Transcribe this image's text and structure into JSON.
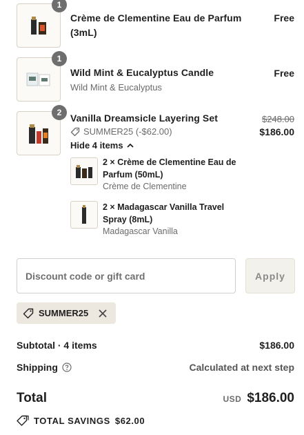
{
  "line_items": [
    {
      "quantity": "1",
      "title": "Crème de Clementine Eau de Parfum (3mL)",
      "subtitle": "",
      "price": "Free"
    },
    {
      "quantity": "1",
      "title": "Wild Mint & Eucalyptus Candle",
      "subtitle": "Wild Mint & Eucalyptus",
      "price": "Free"
    },
    {
      "quantity": "2",
      "title": "Vanilla Dreamsicle Layering Set",
      "original_price": "$248.00",
      "price": "$186.00",
      "discount_code": "SUMMER25 (-$62.00)",
      "toggle_label": "Hide 4 items",
      "components": [
        {
          "title": "2 × Crème de Clementine Eau de Parfum (50mL)",
          "subtitle": "Crème de Clementine"
        },
        {
          "title": "2 × Madagascar Vanilla Travel Spray (8mL)",
          "subtitle": "Madagascar Vanilla"
        }
      ]
    }
  ],
  "discount": {
    "placeholder": "Discount code or gift card",
    "apply_label": "Apply",
    "applied_code": "SUMMER25"
  },
  "summary": {
    "subtotal_label": "Subtotal · 4 items",
    "subtotal_value": "$186.00",
    "shipping_label": "Shipping",
    "shipping_value": "Calculated at next step",
    "total_label": "Total",
    "currency": "USD",
    "total_value": "$186.00",
    "savings_label": "TOTAL SAVINGS",
    "savings_value": "$62.00"
  },
  "colors": {
    "badge": "#6e6e6e",
    "chip_bg": "#ece7df",
    "apply_bg": "#f3f1ec",
    "muted_text": "#6b6b6b"
  },
  "icons": [
    "tag-icon",
    "chevron-up-icon",
    "close-icon",
    "help-circle-icon",
    "savings-tag-icon"
  ]
}
